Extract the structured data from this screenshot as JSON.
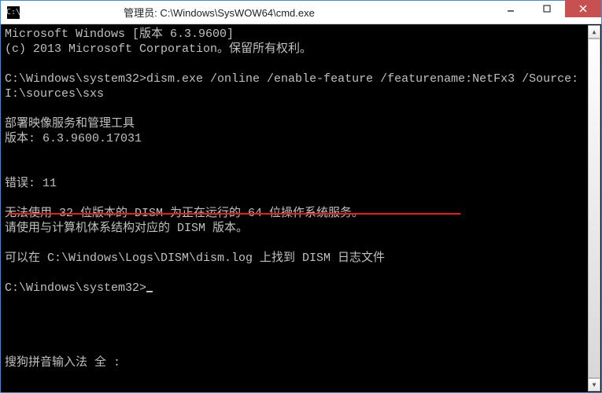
{
  "window": {
    "title": "管理员: C:\\Windows\\SysWOW64\\cmd.exe",
    "icon_label": "C:\\"
  },
  "terminal": {
    "line1": "Microsoft Windows [版本 6.3.9600]",
    "line2": "(c) 2013 Microsoft Corporation。保留所有权利。",
    "blank1": "",
    "prompt1_path": "C:\\Windows\\system32>",
    "prompt1_cmd": "dism.exe /online /enable-feature /featurename:NetFx3 /Source:I:\\sources\\sxs",
    "blank2": "",
    "tool_line1": "部署映像服务和管理工具",
    "tool_line2": "版本: 6.3.9600.17031",
    "blank3": "",
    "blank4": "",
    "error_code": "错误: 11",
    "blank5": "",
    "error_msg1": "无法使用 32 位版本的 DISM 为正在运行的 64 位操作系统服务。",
    "error_msg2": "请使用与计算机体系结构对应的 DISM 版本。",
    "blank6": "",
    "log_msg": "可以在 C:\\Windows\\Logs\\DISM\\dism.log 上找到 DISM 日志文件",
    "blank7": "",
    "prompt2": "C:\\Windows\\system32>",
    "ime_status": "搜狗拼音输入法 全 :"
  },
  "annotation": {
    "underline_color": "#d22",
    "underline_text": "无法使用 32 位版本的 DISM 为正在运行的 64 位操作系统服务。"
  }
}
